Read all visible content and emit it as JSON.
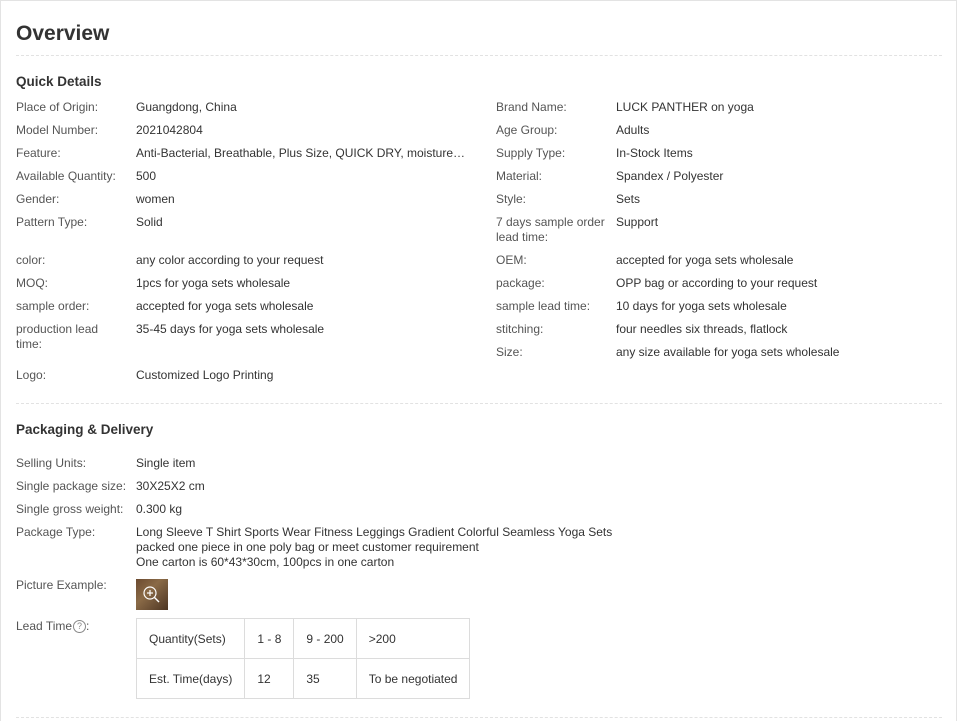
{
  "title": "Overview",
  "quick_details": {
    "heading": "Quick Details",
    "left": [
      {
        "label": "Place of Origin:",
        "value": "Guangdong, China"
      },
      {
        "label": "Model Number:",
        "value": "2021042804"
      },
      {
        "label": "Feature:",
        "value": "Anti-Bacterial, Breathable, Plus Size, QUICK DRY, moisture wi..."
      },
      {
        "label": "Available Quantity:",
        "value": "500"
      },
      {
        "label": "Gender:",
        "value": "women"
      },
      {
        "label": "Pattern Type:",
        "value": "Solid"
      },
      {
        "label": "color:",
        "value": "any color according to your request"
      },
      {
        "label": "MOQ:",
        "value": "1pcs for yoga sets wholesale"
      },
      {
        "label": "sample order:",
        "value": "accepted for yoga sets wholesale"
      },
      {
        "label": "production lead time:",
        "value": "35-45 days for yoga sets wholesale"
      },
      {
        "label": "Logo:",
        "value": "Customized Logo Printing"
      }
    ],
    "right": [
      {
        "label": "Brand Name:",
        "value": "LUCK PANTHER on yoga"
      },
      {
        "label": "Age Group:",
        "value": "Adults"
      },
      {
        "label": "Supply Type:",
        "value": "In-Stock Items"
      },
      {
        "label": "Material:",
        "value": "Spandex / Polyester"
      },
      {
        "label": "Style:",
        "value": "Sets"
      },
      {
        "label": "7 days sample order lead time:",
        "value": "Support"
      },
      {
        "label": "OEM:",
        "value": "accepted for yoga sets wholesale"
      },
      {
        "label": "package:",
        "value": "OPP bag or according to your request"
      },
      {
        "label": "sample lead time:",
        "value": "10 days for yoga sets wholesale"
      },
      {
        "label": "stitching:",
        "value": "four needles six threads, flatlock"
      },
      {
        "label": "Size:",
        "value": "any size available for yoga sets wholesale"
      }
    ]
  },
  "packaging": {
    "heading": "Packaging & Delivery",
    "rows": [
      {
        "label": "Selling Units:",
        "value": "Single item"
      },
      {
        "label": "Single package size:",
        "value": "30X25X2 cm"
      },
      {
        "label": "Single gross weight:",
        "value": "0.300 kg"
      }
    ],
    "package_type_label": "Package Type:",
    "package_type_lines": [
      "Long Sleeve T Shirt Sports Wear Fitness Leggings Gradient Colorful Seamless Yoga Sets",
      "packed one piece in one poly bag or meet customer requirement",
      "One carton is 60*43*30cm, 100pcs in one carton"
    ],
    "picture_label": "Picture Example:",
    "zoom_icon": "zoom-in-icon",
    "lead_time_label": "Lead Time",
    "help_icon": "?",
    "lead_table": {
      "quantity_header": "Quantity(Sets)",
      "quantities": [
        "1 - 8",
        "9 - 200",
        ">200"
      ],
      "time_header": "Est. Time(days)",
      "times": [
        "12",
        "35",
        "To be negotiated"
      ]
    }
  }
}
